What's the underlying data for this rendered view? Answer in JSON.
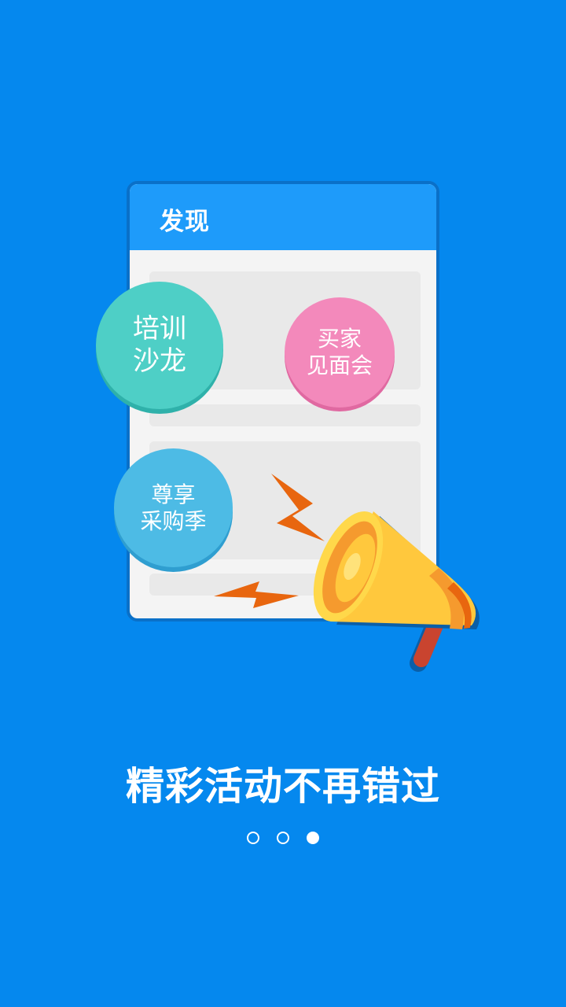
{
  "card": {
    "title": "发现"
  },
  "bubbles": {
    "training": {
      "line1": "培训",
      "line2": "沙龙",
      "color": "#4ECFC6"
    },
    "buyer": {
      "line1": "买家",
      "line2": "见面会",
      "color": "#F389BB"
    },
    "purchase": {
      "line1": "尊享",
      "line2": "采购季",
      "color": "#4DBBE5"
    }
  },
  "headline": "精彩活动不再错过",
  "pager": {
    "total": 3,
    "active_index": 2
  },
  "colors": {
    "background": "#0588EE",
    "card_header": "#1E9BFA",
    "megaphone": "#FFC83D",
    "lightning": "#E8660F"
  },
  "icons": {
    "megaphone": "megaphone-icon",
    "lightning": "lightning-icon"
  }
}
